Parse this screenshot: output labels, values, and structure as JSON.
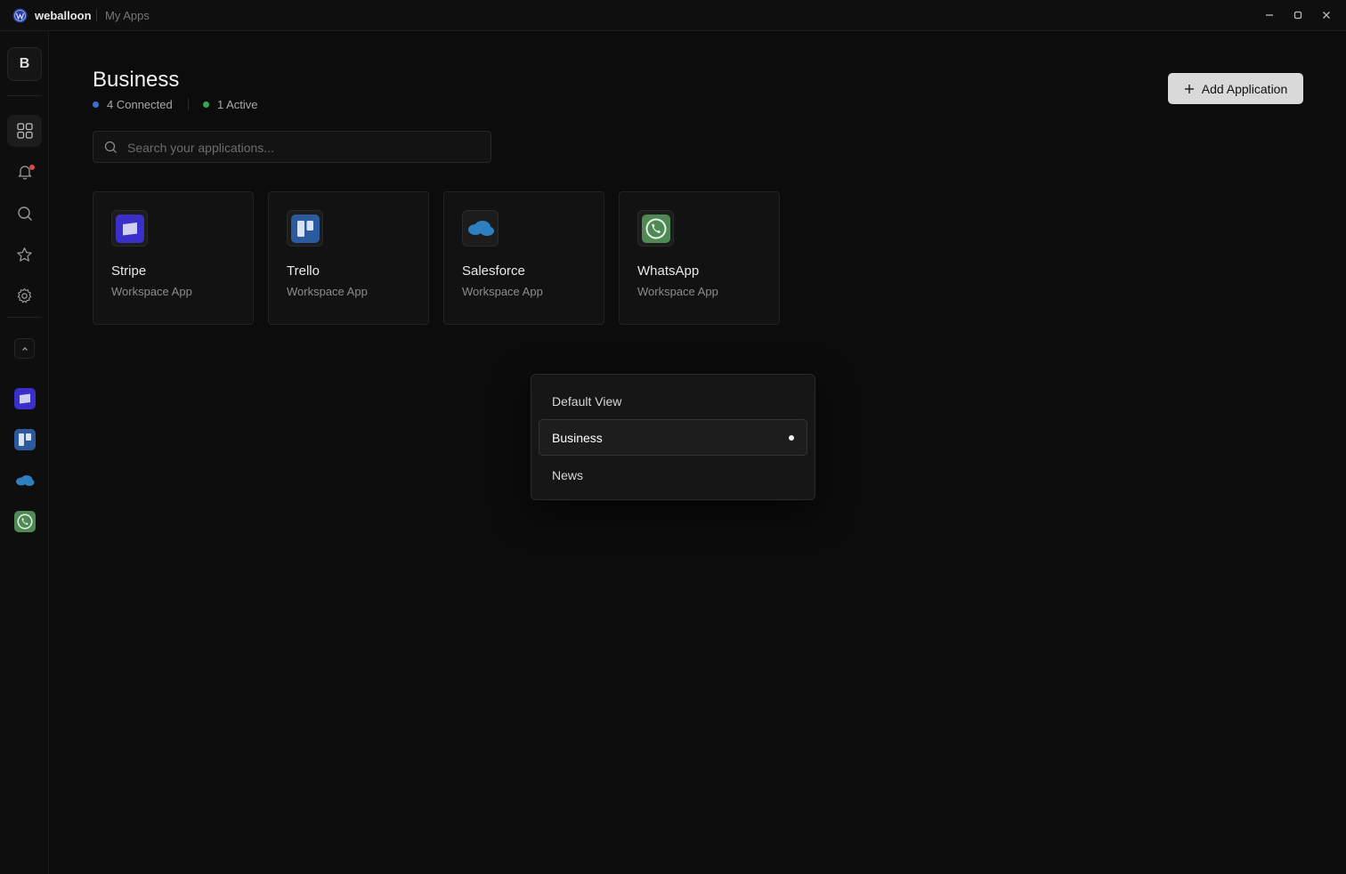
{
  "titlebar": {
    "app_name": "weballoon",
    "page": "My Apps",
    "controls": [
      "minimize-icon",
      "maximize-icon",
      "close-icon"
    ]
  },
  "sidebar": {
    "workspace_initial": "B",
    "nav": [
      {
        "icon": "grid-icon",
        "active": true
      },
      {
        "icon": "bell-icon",
        "notification": true
      },
      {
        "icon": "search-icon"
      },
      {
        "icon": "star-icon"
      },
      {
        "icon": "gear-icon"
      }
    ],
    "collapse_icon": "chevron-up-icon",
    "apps": [
      "stripe-icon",
      "trello-icon",
      "salesforce-icon",
      "whatsapp-icon"
    ]
  },
  "header": {
    "title": "Business",
    "connected": "4 Connected",
    "active": "1 Active",
    "connected_color": "#3b6fd6",
    "active_color": "#3aa655",
    "add_button": "Add Application"
  },
  "search": {
    "placeholder": "Search your applications...",
    "value": ""
  },
  "apps": [
    {
      "name": "Stripe",
      "subtitle": "Workspace App",
      "icon": "stripe-icon"
    },
    {
      "name": "Trello",
      "subtitle": "Workspace App",
      "icon": "trello-icon"
    },
    {
      "name": "Salesforce",
      "subtitle": "Workspace App",
      "icon": "salesforce-icon"
    },
    {
      "name": "WhatsApp",
      "subtitle": "Workspace App",
      "icon": "whatsapp-icon"
    }
  ],
  "view_menu": {
    "items": [
      "Default View",
      "Business",
      "News"
    ],
    "selected": "Business"
  }
}
